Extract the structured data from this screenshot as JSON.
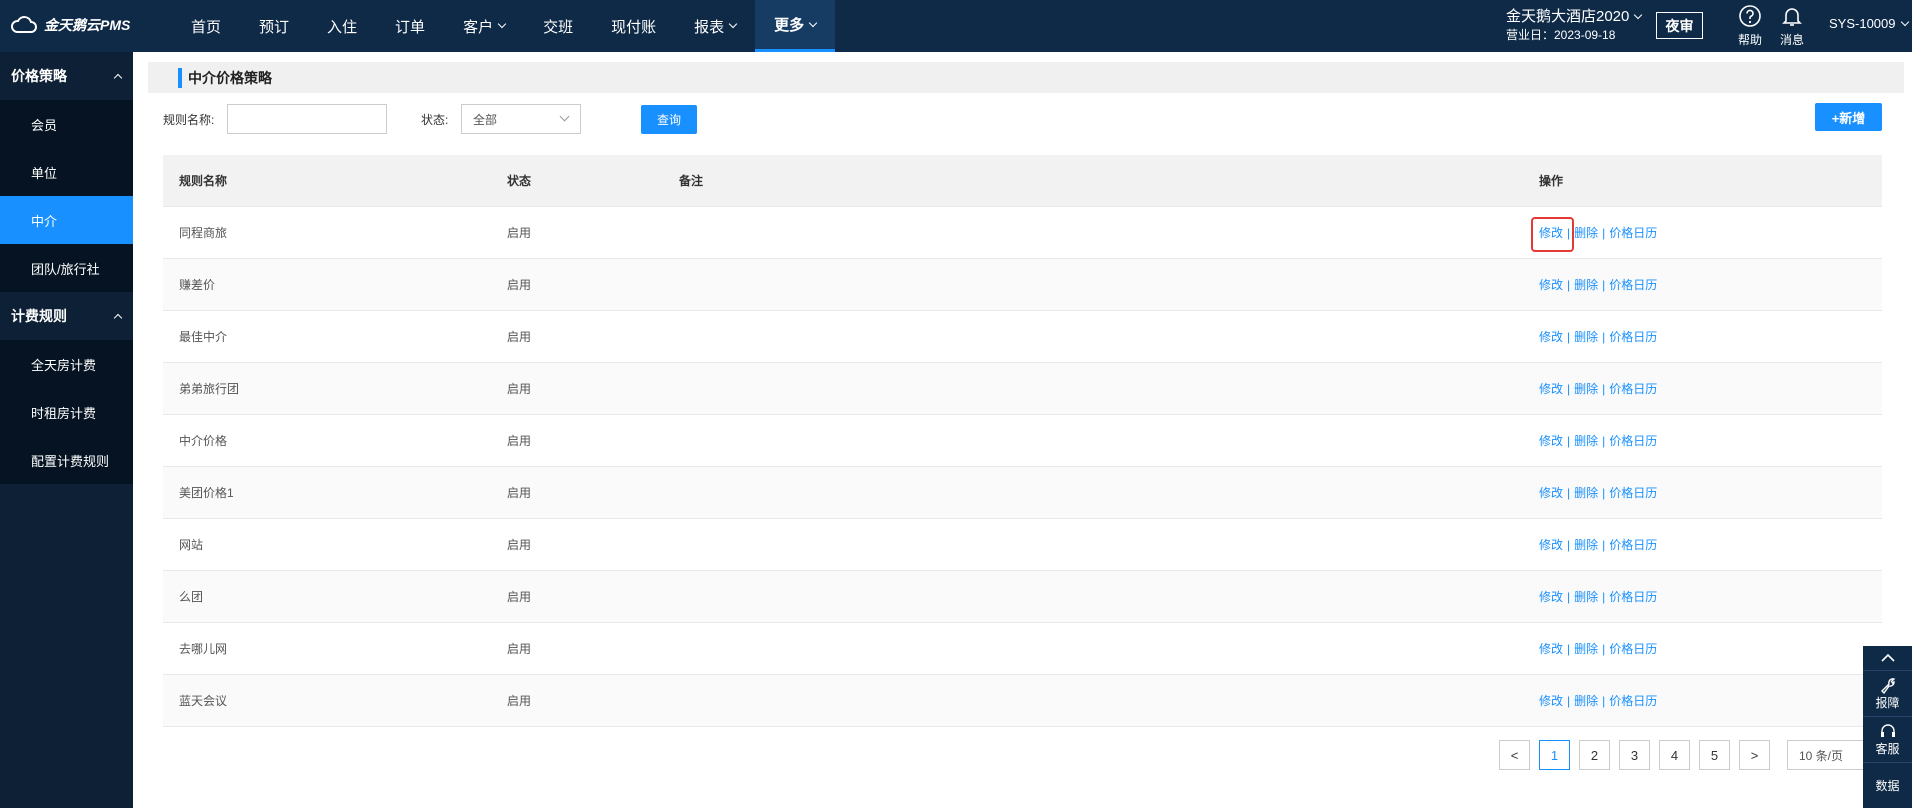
{
  "app": {
    "logo_text": "金天鹅云PMS"
  },
  "nav": {
    "items": [
      {
        "label": "首页"
      },
      {
        "label": "预订"
      },
      {
        "label": "入住"
      },
      {
        "label": "订单"
      },
      {
        "label": "客户"
      },
      {
        "label": "交班"
      },
      {
        "label": "现付账"
      },
      {
        "label": "报表"
      },
      {
        "label": "更多"
      }
    ],
    "active": "更多"
  },
  "hotel": {
    "name": "金天鹅大酒店2020",
    "business_date": "营业日：2023-09-18"
  },
  "header": {
    "audit": "夜审",
    "help": "帮助",
    "message": "消息",
    "user": "SYS-10009"
  },
  "sidebar": {
    "groups": [
      {
        "label": "价格策略",
        "items": [
          "会员",
          "单位",
          "中介",
          "团队/旅行社"
        ]
      },
      {
        "label": "计费规则",
        "items": [
          "全天房计费",
          "时租房计费",
          "配置计费规则"
        ]
      }
    ],
    "active_item": "中介"
  },
  "page": {
    "title": "中介价格策略"
  },
  "filter": {
    "name_label": "规则名称:",
    "name_value": "",
    "status_label": "状态:",
    "status_value": "全部",
    "query_button": "查询",
    "add_button": "+新增"
  },
  "table": {
    "columns": [
      "规则名称",
      "状态",
      "备注",
      "操作"
    ],
    "rows": [
      {
        "name": "同程商旅",
        "status": "启用",
        "note": ""
      },
      {
        "name": "赚差价",
        "status": "启用",
        "note": ""
      },
      {
        "name": "最佳中介",
        "status": "启用",
        "note": ""
      },
      {
        "name": "弟弟旅行团",
        "status": "启用",
        "note": ""
      },
      {
        "name": "中介价格",
        "status": "启用",
        "note": ""
      },
      {
        "name": "美团价格1",
        "status": "启用",
        "note": ""
      },
      {
        "name": "网站",
        "status": "启用",
        "note": ""
      },
      {
        "name": "么团",
        "status": "启用",
        "note": ""
      },
      {
        "name": "去哪儿网",
        "status": "启用",
        "note": ""
      },
      {
        "name": "蓝天会议",
        "status": "启用",
        "note": ""
      }
    ],
    "actions": {
      "edit": "修改",
      "delete": "删除",
      "calendar": "价格日历",
      "sep": "|"
    }
  },
  "pager": {
    "prev": "<",
    "next": ">",
    "pages": [
      "1",
      "2",
      "3",
      "4",
      "5"
    ],
    "current": "1",
    "page_size": "10 条/页"
  },
  "floatbar": {
    "report": "报障",
    "service": "客服",
    "data": "数据"
  }
}
